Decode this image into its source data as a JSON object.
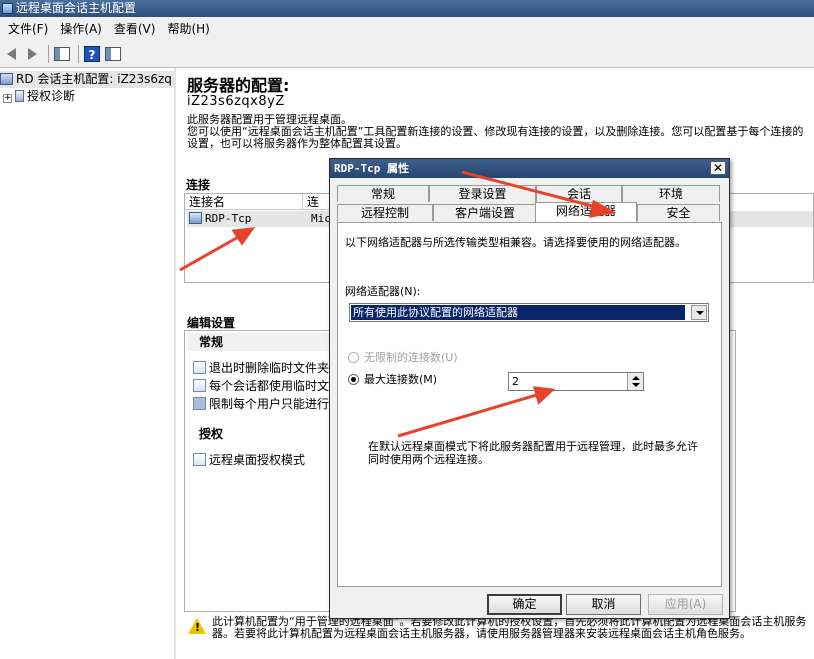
{
  "window": {
    "title": "远程桌面会话主机配置"
  },
  "menu": [
    "文件(F)",
    "操作(A)",
    "查看(V)",
    "帮助(H)"
  ],
  "toolbar": {
    "buttons": [
      "back-icon",
      "forward-icon",
      "show-hide-console-tree-icon",
      "help-icon",
      "action-pane-icon"
    ]
  },
  "tree": {
    "root": "RD 会话主机配置: iZ23s6zq",
    "child": "授权诊断"
  },
  "main": {
    "title": "服务器的配置:",
    "server_name": "iZ23s6zqx8yZ",
    "description": "此服务器配置用于管理远程桌面。\n您可以使用“远程桌面会话主机配置”工具配置新连接的设置、修改现有连接的设置，以及删除连接。您可以配置基于每个连接的设置，也可以将服务器作为整体配置其设置。",
    "connections_label": "连接",
    "columns": [
      "连接名",
      "连"
    ],
    "connection_name": "RDP-Tcp",
    "connection_col2": "Mic",
    "edit_settings_label": "编辑设置",
    "general_group": "常规",
    "general_items": [
      "退出时删除临时文件夹",
      "每个会话都使用临时文",
      "限制每个用户只能进行"
    ],
    "licensing_group": "授权",
    "licensing_items": [
      "远程桌面授权模式"
    ],
    "warning_text": "此计算机配置为“用于管理的远程桌面”。若要修改此计算机的授权设置，首先必须将此计算机配置为远程桌面会话主机服务器。若要将此计算机配置为远程桌面会话主机服务器，请使用服务器管理器来安装远程桌面会话主机角色服务。"
  },
  "dialog": {
    "title": "RDP-Tcp 属性",
    "close_glyph": "✕",
    "tabs_top": [
      "常规",
      "登录设置",
      "会话",
      "环境"
    ],
    "tabs_bottom": [
      "远程控制",
      "客户端设置",
      "网络适配器",
      "安全"
    ],
    "active_tab": "网络适配器",
    "intro": "以下网络适配器与所选传输类型相兼容。请选择要使用的网络适配器。",
    "adapter_label": "网络适配器(N):",
    "adapter_value": "所有使用此协议配置的网络适配器",
    "unlimited_label": "无限制的连接数(U)",
    "max_label": "最大连接数(M)",
    "max_value": "2",
    "note": "在默认远程桌面模式下将此服务器配置用于远程管理，此时最多允许同时使用两个远程连接。",
    "ok": "确定",
    "cancel": "取消",
    "apply": "应用(A)"
  },
  "colors": {
    "titlebar": "#2c4f7e",
    "selection": "#0a246a",
    "annotation_arrow": "#e8412c",
    "warning": "#f2c200"
  }
}
